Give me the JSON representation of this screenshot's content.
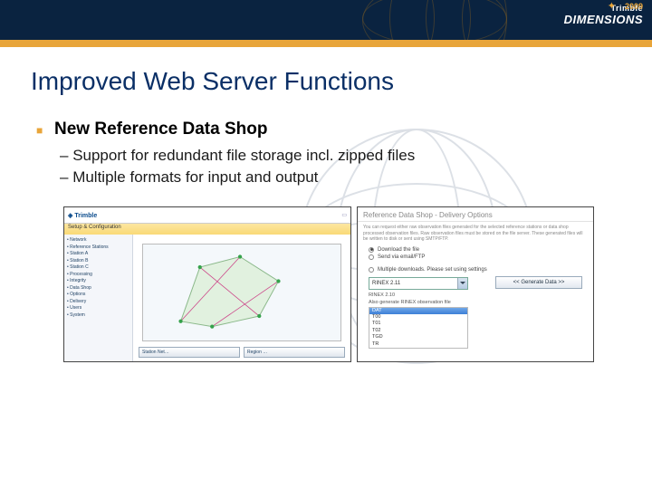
{
  "header": {
    "brand": "Trimble",
    "event": "DIMENSIONS",
    "year": "2009"
  },
  "title": "Improved Web Server Functions",
  "section": {
    "heading": "New Reference Data Shop",
    "items": [
      "Support for redundant file storage incl. zipped files",
      "Multiple formats for input and output"
    ]
  },
  "screenshots": {
    "left": {
      "logo": "Trimble",
      "tab": "Setup & Configuration",
      "tree": [
        "• Network",
        "  • Reference Stations",
        "    • Station A",
        "    • Station B",
        "    • Station C",
        "  • Processing",
        "  • Integrity",
        "• Data Shop",
        "  • Options",
        "  • Delivery",
        "• Users",
        "• System"
      ],
      "dropdown1": "Station Net…",
      "dropdown2": "Region …"
    },
    "right": {
      "title": "Reference Data Shop - Delivery Options",
      "intro": "You can request either raw observation files generated for the selected reference stations or data shop processed observation files. Raw observation files must be stored on the file server. These generated files will be written to disk or sent using SMTP/FTP.",
      "opt1": "Download the file",
      "opt2": "Send via email/FTP",
      "opt3": "Multiple downloads. Please set using settings",
      "select_value": "RINEX 2.11",
      "line_under": "RINEX 2.10",
      "line_under2": "Also generate RINEX observation file",
      "list": [
        "DAT",
        "T00",
        "T01",
        "T02",
        "TGD",
        "TR"
      ],
      "button": "<< Generate Data >>"
    }
  }
}
